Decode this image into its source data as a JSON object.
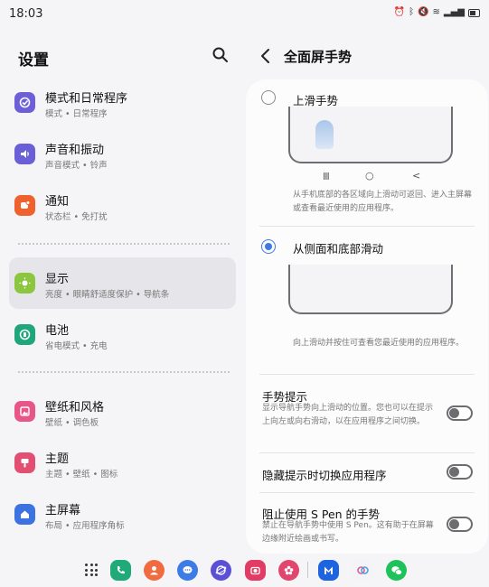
{
  "status_bar": {
    "time": "18:03"
  },
  "settings_pane": {
    "title": "设置",
    "items": [
      {
        "title": "模式和日常程序",
        "subtitle": "模式 • 日常程序",
        "icon": "modes-routines-icon",
        "color": "#6c5fd8"
      },
      {
        "title": "声音和振动",
        "subtitle": "声音模式 • 铃声",
        "icon": "sound-icon",
        "color": "#6a5fd6"
      },
      {
        "title": "通知",
        "subtitle": "状态栏 • 免打扰",
        "icon": "notification-icon",
        "color": "#f0622d"
      },
      {
        "title": "显示",
        "subtitle": "亮度 • 眼睛舒适度保护 • 导航条",
        "icon": "display-icon",
        "color": "#8cc63f"
      },
      {
        "title": "电池",
        "subtitle": "省电模式 • 充电",
        "icon": "battery-icon",
        "color": "#1fa67a"
      },
      {
        "title": "壁纸和风格",
        "subtitle": "壁纸 • 调色板",
        "icon": "wallpaper-icon",
        "color": "#e85587"
      },
      {
        "title": "主题",
        "subtitle": "主题 • 壁纸 • 图标",
        "icon": "themes-icon",
        "color": "#e34f72"
      },
      {
        "title": "主屏幕",
        "subtitle": "布局 • 应用程序角标",
        "icon": "home-screen-icon",
        "color": "#3d73e0"
      }
    ],
    "selected": "显示"
  },
  "gesture_pane": {
    "title": "全面屏手势",
    "options": [
      {
        "label": "上滑手势",
        "checked": false,
        "description": "从手机底部的各区域向上滑动可返回、进入主屏幕或查看最近使用的应用程序。"
      },
      {
        "label": "从侧面和底部滑动",
        "checked": true,
        "description": "向上滑动并按住可查看您最近使用的应用程序。"
      }
    ],
    "nav_glyphs": [
      "III",
      "○",
      "<"
    ],
    "settings": [
      {
        "title": "手势提示",
        "description": "显示导航手势向上滑动的位置。您也可以在提示上向左或向右滑动，以在应用程序之间切换。",
        "enabled": false
      },
      {
        "title": "隐藏提示时切换应用程序",
        "description": "",
        "enabled": false
      },
      {
        "title": "阻止使用 S Pen 的手势",
        "description": "禁止在导航手势中使用 S Pen。这有助于在屏幕边缘附近绘画或书写。",
        "enabled": false
      }
    ]
  },
  "dock": {
    "apps": [
      "phone-app-icon",
      "contacts-app-icon",
      "messages-app-icon",
      "internet-app-icon",
      "camera-app-icon",
      "gallery-app-icon",
      "mango-app-icon",
      "link-app-icon",
      "wechat-app-icon"
    ]
  }
}
